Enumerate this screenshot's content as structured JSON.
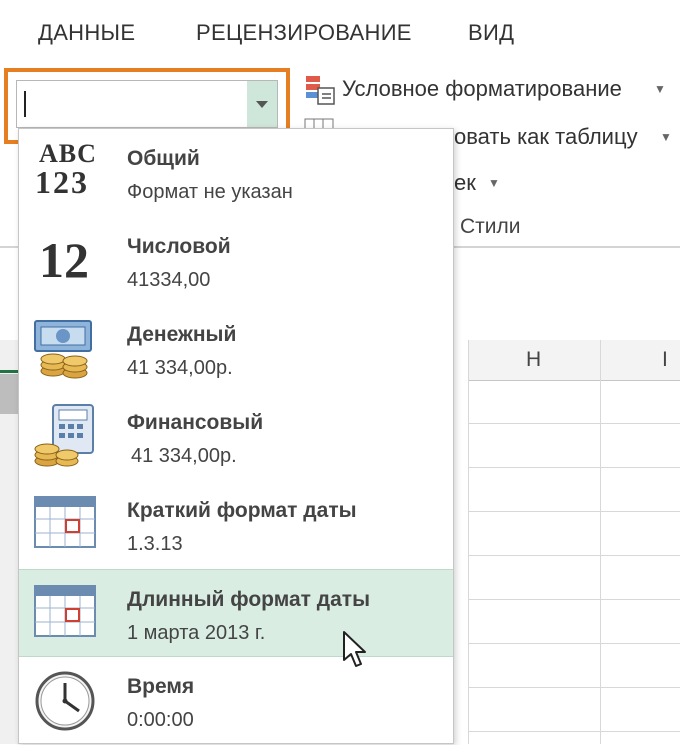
{
  "ribbon": {
    "tabs": [
      "ДАННЫЕ",
      "РЕЦЕНЗИРОВАНИЕ",
      "ВИД"
    ],
    "conditional_formatting": "Условное форматирование",
    "format_as_table": "овать как таблицу",
    "cell_styles": "ек",
    "styles_group_label": "Стили"
  },
  "number_format_box": {
    "value": ""
  },
  "format_list": [
    {
      "name": "Общий",
      "example": "Формат не указан",
      "icon": "abc-123-icon"
    },
    {
      "name": "Числовой",
      "example": "41334,00",
      "icon": "number-12-icon"
    },
    {
      "name": "Денежный",
      "example": "41 334,00р.",
      "icon": "currency-icon"
    },
    {
      "name": "Финансовый",
      "example": "41 334,00р.",
      "icon": "accounting-icon"
    },
    {
      "name": "Краткий формат даты",
      "example": "1.3.13",
      "icon": "short-date-calendar-icon"
    },
    {
      "name": "Длинный формат даты",
      "example": "1 марта 2013 г.",
      "icon": "long-date-calendar-icon"
    },
    {
      "name": "Время",
      "example": "0:00:00",
      "icon": "clock-icon"
    }
  ],
  "highlighted_item": "Длинный формат даты",
  "column_headers": [
    "H",
    "I"
  ],
  "colors": {
    "combo_highlight": "#e67e22",
    "hover_item": "#d9ede3",
    "excel_green": "#217346"
  }
}
